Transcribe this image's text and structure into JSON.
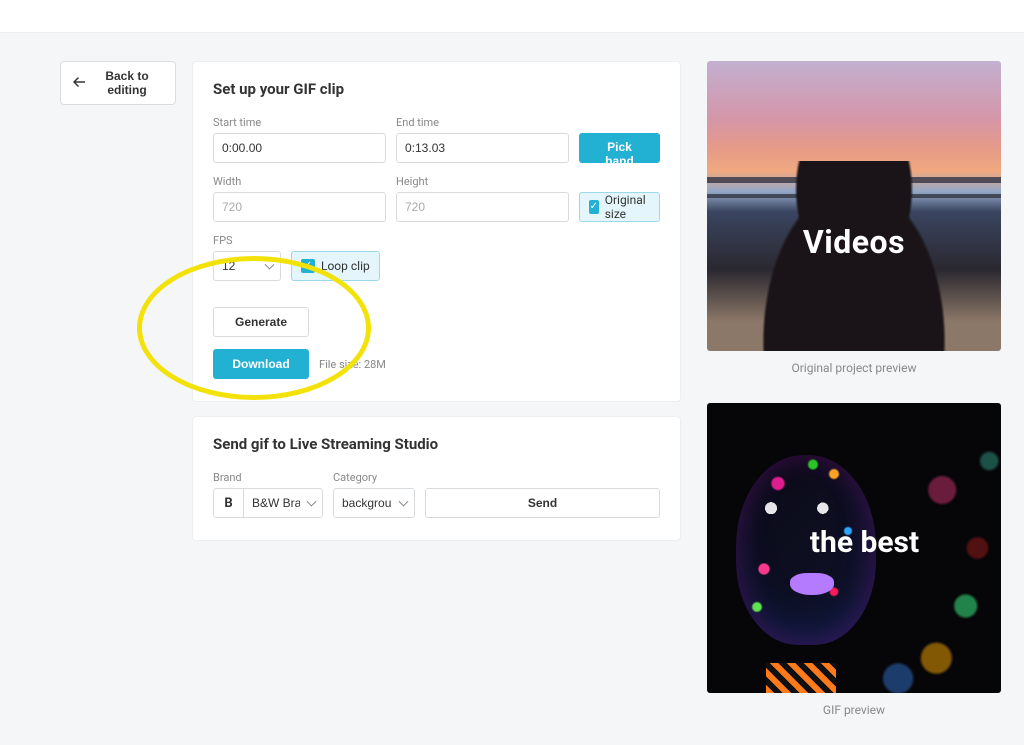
{
  "back_label": "Back to editing",
  "card1": {
    "title": "Set up your GIF clip",
    "start_label": "Start time",
    "start_value": "0:00.00",
    "end_label": "End time",
    "end_value": "0:13.03",
    "pick_band": "Pick band",
    "width_label": "Width",
    "width_placeholder": "720",
    "height_label": "Height",
    "height_placeholder": "720",
    "original_size": "Original size",
    "fps_label": "FPS",
    "fps_value": "12",
    "loop_clip": "Loop clip",
    "generate": "Generate",
    "download": "Download",
    "file_size": "File size: 28M"
  },
  "card2": {
    "title": "Send gif to Live Streaming Studio",
    "brand_label": "Brand",
    "brand_letter": "B",
    "brand_value": "B&W Brand",
    "category_label": "Category",
    "category_value": "background",
    "send": "Send"
  },
  "previews": {
    "original_caption": "Original project preview",
    "original_text": "Videos",
    "gif_caption": "GIF preview",
    "gif_text": "the best"
  }
}
